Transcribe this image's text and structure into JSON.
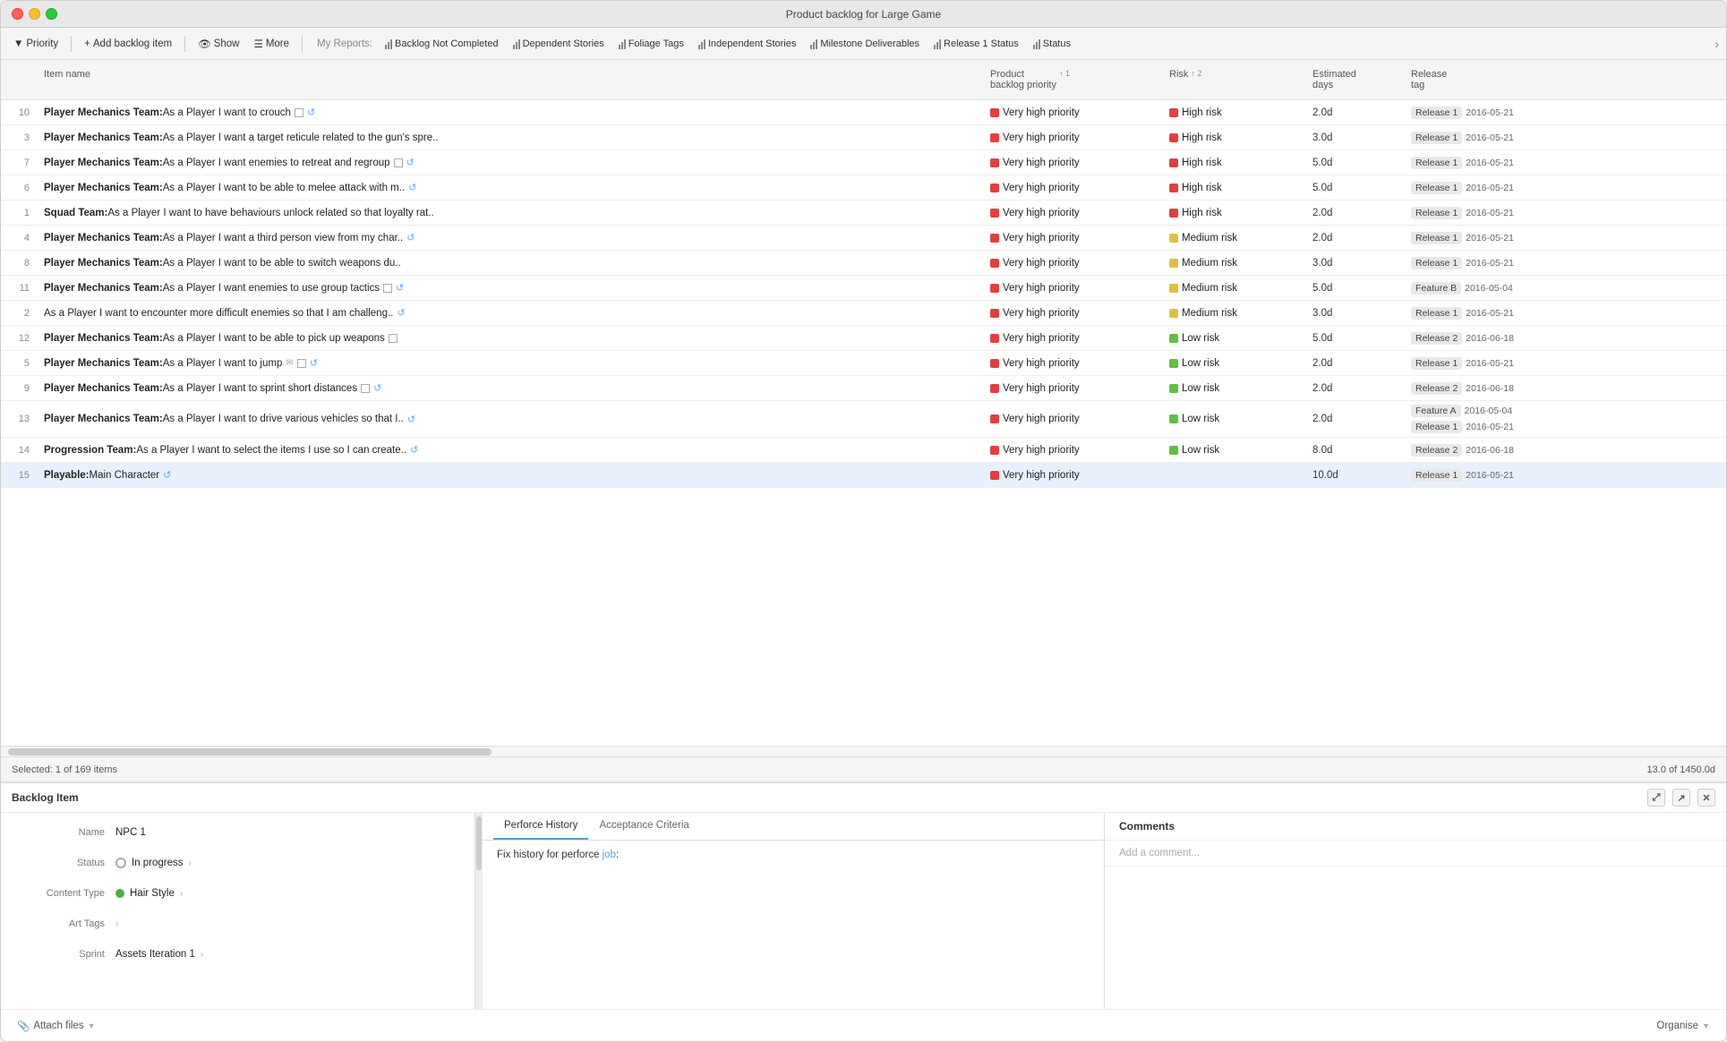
{
  "window": {
    "title": "Product backlog for Large Game"
  },
  "toolbar": {
    "priority_label": "Priority",
    "add_backlog_label": "Add backlog item",
    "show_label": "Show",
    "more_label": "More",
    "my_reports_label": "My Reports:",
    "reports": [
      {
        "id": "backlog-not-completed",
        "label": "Backlog Not Completed"
      },
      {
        "id": "dependent-stories",
        "label": "Dependent Stories"
      },
      {
        "id": "foliage-tags",
        "label": "Foliage Tags"
      },
      {
        "id": "independent-stories",
        "label": "Independent Stories"
      },
      {
        "id": "milestone-deliverables",
        "label": "Milestone Deliverables"
      },
      {
        "id": "release-1-status",
        "label": "Release 1 Status"
      },
      {
        "id": "status",
        "label": "Status"
      }
    ]
  },
  "table": {
    "columns": [
      {
        "id": "num",
        "label": ""
      },
      {
        "id": "name",
        "label": "Item name"
      },
      {
        "id": "priority",
        "label": "Product backlog priority",
        "sort": "↑ 1"
      },
      {
        "id": "risk",
        "label": "Risk",
        "sort": "↑ 2"
      },
      {
        "id": "days",
        "label": "Estimated days"
      },
      {
        "id": "release",
        "label": "Release tag"
      }
    ],
    "rows": [
      {
        "num": "10",
        "name": "Player Mechanics Team: As a Player I want to crouch",
        "priority": "Very high priority",
        "priority_color": "red",
        "risk": "High risk",
        "risk_color": "red",
        "days": "2.0d",
        "release_tag": "Release 1",
        "release_date": "2016-05-21",
        "has_checkbox": true,
        "has_spiral": true,
        "selected": false
      },
      {
        "num": "3",
        "name": "Player Mechanics Team: As a Player I want a target reticule related to the gun's spre..",
        "priority": "Very high priority",
        "priority_color": "red",
        "risk": "High risk",
        "risk_color": "red",
        "days": "3.0d",
        "release_tag": "Release 1",
        "release_date": "2016-05-21",
        "has_checkbox": false,
        "has_spiral": false,
        "selected": false
      },
      {
        "num": "7",
        "name": "Player Mechanics Team: As a Player I want enemies to retreat and regroup",
        "priority": "Very high priority",
        "priority_color": "red",
        "risk": "High risk",
        "risk_color": "red",
        "days": "5.0d",
        "release_tag": "Release 1",
        "release_date": "2016-05-21",
        "has_checkbox": true,
        "has_spiral": true,
        "selected": false
      },
      {
        "num": "6",
        "name": "Player Mechanics Team: As a Player I want to be able to melee attack with m..",
        "priority": "Very high priority",
        "priority_color": "red",
        "risk": "High risk",
        "risk_color": "red",
        "days": "5.0d",
        "release_tag": "Release 1",
        "release_date": "2016-05-21",
        "has_checkbox": false,
        "has_spiral": true,
        "selected": false
      },
      {
        "num": "1",
        "name": "Squad Team: As a Player I want to have behaviours unlock related so that loyalty rat..",
        "priority": "Very high priority",
        "priority_color": "red",
        "risk": "High risk",
        "risk_color": "red",
        "days": "2.0d",
        "release_tag": "Release 1",
        "release_date": "2016-05-21",
        "has_checkbox": false,
        "has_spiral": false,
        "selected": false
      },
      {
        "num": "4",
        "name": "Player Mechanics Team: As a Player I want a third person view from my char..",
        "priority": "Very high priority",
        "priority_color": "red",
        "risk": "Medium risk",
        "risk_color": "yellow",
        "days": "2.0d",
        "release_tag": "Release 1",
        "release_date": "2016-05-21",
        "has_checkbox": false,
        "has_spiral": true,
        "selected": false
      },
      {
        "num": "8",
        "name": "Player Mechanics Team: As a Player I want to be able to switch weapons du..",
        "priority": "Very high priority",
        "priority_color": "red",
        "risk": "Medium risk",
        "risk_color": "yellow",
        "days": "3.0d",
        "release_tag": "Release 1",
        "release_date": "2016-05-21",
        "has_checkbox": false,
        "has_spiral": false,
        "selected": false
      },
      {
        "num": "11",
        "name": "Player Mechanics Team: As a Player I want enemies to use group tactics",
        "priority": "Very high priority",
        "priority_color": "red",
        "risk": "Medium risk",
        "risk_color": "yellow",
        "days": "5.0d",
        "release_tag": "Feature B",
        "release_date": "2016-05-04",
        "has_checkbox": true,
        "has_spiral": true,
        "selected": false
      },
      {
        "num": "2",
        "name": "As a Player I want to encounter more difficult enemies so that I am challeng..",
        "priority": "Very high priority",
        "priority_color": "red",
        "risk": "Medium risk",
        "risk_color": "yellow",
        "days": "3.0d",
        "release_tag": "Release 1",
        "release_date": "2016-05-21",
        "has_checkbox": false,
        "has_spiral": true,
        "selected": false,
        "bold_name": true
      },
      {
        "num": "12",
        "name": "Player Mechanics Team: As a Player I want to be able to pick up weapons",
        "priority": "Very high priority",
        "priority_color": "red",
        "risk": "Low risk",
        "risk_color": "green",
        "days": "5.0d",
        "release_tag": "Release 2",
        "release_date": "2016-06-18",
        "has_checkbox": true,
        "has_spiral": false,
        "selected": false
      },
      {
        "num": "5",
        "name": "Player Mechanics Team: As a Player I want to jump",
        "priority": "Very high priority",
        "priority_color": "red",
        "risk": "Low risk",
        "risk_color": "green",
        "days": "2.0d",
        "release_tag": "Release 1",
        "release_date": "2016-05-21",
        "has_checkbox": true,
        "has_spiral": true,
        "has_mail": true,
        "selected": false
      },
      {
        "num": "9",
        "name": "Player Mechanics Team: As a Player I want to sprint short distances",
        "priority": "Very high priority",
        "priority_color": "red",
        "risk": "Low risk",
        "risk_color": "green",
        "days": "2.0d",
        "release_tag": "Release 2",
        "release_date": "2016-06-18",
        "has_checkbox": true,
        "has_spiral": true,
        "selected": false
      },
      {
        "num": "13",
        "name": "Player Mechanics Team: As a Player I want to drive various vehicles so that I..",
        "priority": "Very high priority",
        "priority_color": "red",
        "risk": "Low risk",
        "risk_color": "green",
        "days": "2.0d",
        "release_tag": "Feature A",
        "release_date": "2016-05-04",
        "release_tag2": "Release 1",
        "release_date2": "2016-05-21",
        "has_checkbox": false,
        "has_spiral": true,
        "selected": false
      },
      {
        "num": "14",
        "name": "Progression Team: As a Player I want to select the items I use so I can create..",
        "priority": "Very high priority",
        "priority_color": "red",
        "risk": "Low risk",
        "risk_color": "green",
        "days": "8.0d",
        "release_tag": "Release 2",
        "release_date": "2016-06-18",
        "has_checkbox": false,
        "has_spiral": true,
        "selected": false
      },
      {
        "num": "15",
        "name": "Playable: Main Character",
        "priority": "Very high priority",
        "priority_color": "red",
        "risk": "",
        "risk_color": "",
        "days": "10.0d",
        "release_tag": "Release 1",
        "release_date": "2016-05-21",
        "has_checkbox": false,
        "has_spiral": true,
        "selected": true
      }
    ]
  },
  "status_bar": {
    "selection": "Selected: 1 of 169 items",
    "total": "13.0 of 1450.0d"
  },
  "bottom_panel": {
    "title": "Backlog Item",
    "tabs": [
      {
        "id": "perforce",
        "label": "Perforce History",
        "active": true
      },
      {
        "id": "acceptance",
        "label": "Acceptance Criteria",
        "active": false
      }
    ],
    "tab_content": "Fix history for perforce job:",
    "comments_tab": "Comments",
    "comment_placeholder": "Add a comment...",
    "fields": [
      {
        "label": "Name",
        "value": "NPC 1",
        "type": "text"
      },
      {
        "label": "Status",
        "value": "In progress",
        "type": "status"
      },
      {
        "label": "Content Type",
        "value": "Hair Style",
        "type": "content"
      },
      {
        "label": "Art Tags",
        "value": "",
        "type": "tags"
      },
      {
        "label": "Sprint",
        "value": "Assets Iteration 1",
        "type": "sprint"
      }
    ],
    "footer": {
      "attach_label": "Attach files",
      "organise_label": "Organise"
    }
  }
}
